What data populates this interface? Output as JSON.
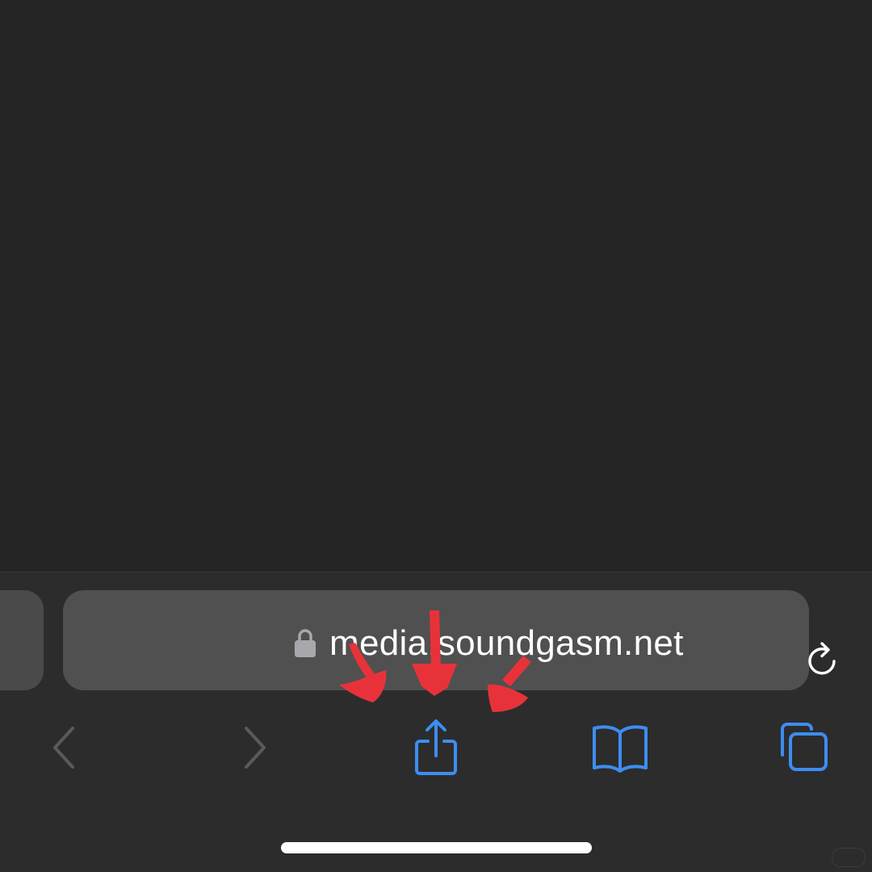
{
  "address_bar": {
    "url": "media.soundgasm.net",
    "lock_icon": "lock-icon",
    "reload_icon": "reload-icon"
  },
  "toolbar": {
    "back_icon": "chevron-left-icon",
    "forward_icon": "chevron-right-icon",
    "share_icon": "share-icon",
    "bookmarks_icon": "book-icon",
    "tabs_icon": "tabs-icon"
  },
  "colors": {
    "background": "#252526",
    "toolbar": "#2c2c2d",
    "address_bar": "#505050",
    "accent_blue": "#3d8ef0",
    "disabled_gray": "#5a5a5c",
    "annotation_red": "#e8323a"
  }
}
